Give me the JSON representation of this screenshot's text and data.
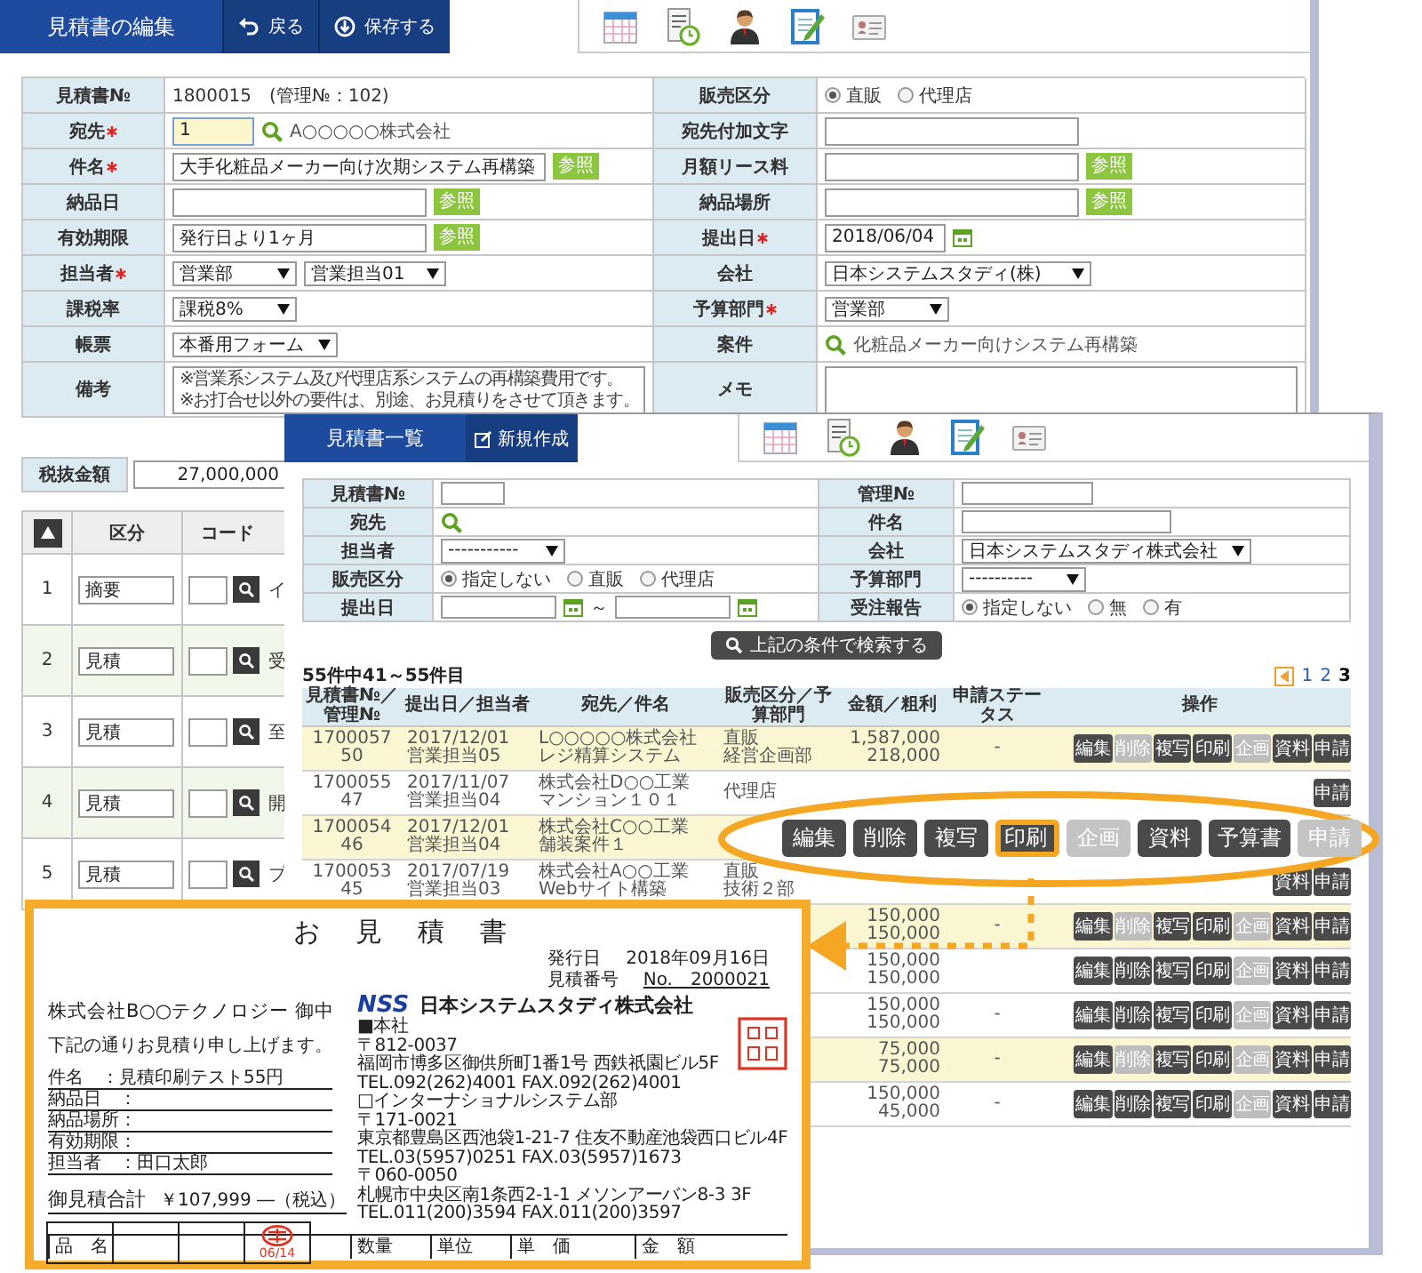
{
  "edit_window": {
    "title": "見積書の編集",
    "actions": [
      {
        "kind": "back",
        "label": "戻る"
      },
      {
        "kind": "save",
        "label": "保存する"
      }
    ],
    "form_rows": [
      {
        "cells": [
          {
            "label": "見積書№",
            "required": false,
            "kind": "text",
            "value": "1800015　(管理№：102)"
          },
          {
            "label": "販売区分",
            "required": false,
            "kind": "radio",
            "options": [
              {
                "label": "直販",
                "selected": true
              },
              {
                "label": "代理店",
                "selected": false
              }
            ]
          }
        ]
      },
      {
        "cells": [
          {
            "label": "宛先",
            "required": true,
            "kind": "lookup",
            "value": "1",
            "focused": true,
            "link_text": "A○○○○○株式会社"
          },
          {
            "label": "宛先付加文字",
            "required": false,
            "kind": "input",
            "focused": false
          }
        ]
      },
      {
        "cells": [
          {
            "label": "件名",
            "required": true,
            "kind": "input",
            "value": "大手化粧品メーカー向け次期システム再構築",
            "focused": false,
            "button": "参照"
          },
          {
            "label": "月額リース料",
            "required": false,
            "kind": "input",
            "focused": false,
            "button": "参照"
          }
        ]
      },
      {
        "cells": [
          {
            "label": "納品日",
            "required": false,
            "kind": "input",
            "focused": false,
            "button": "参照"
          },
          {
            "label": "納品場所",
            "required": false,
            "kind": "input",
            "focused": false,
            "button": "参照"
          }
        ]
      },
      {
        "cells": [
          {
            "label": "有効期限",
            "required": false,
            "kind": "input",
            "value": "発行日より1ヶ月",
            "focused": false,
            "button": "参照"
          },
          {
            "label": "提出日",
            "required": true,
            "kind": "date",
            "value": "2018/06/04",
            "focused": false
          }
        ]
      },
      {
        "cells": [
          {
            "label": "担当者",
            "required": true,
            "kind": "select",
            "selects": [
              "営業部",
              "営業担当01"
            ]
          },
          {
            "label": "会社",
            "required": false,
            "kind": "select",
            "selects": [
              "日本システムスタディ(株)"
            ]
          }
        ]
      },
      {
        "cells": [
          {
            "label": "課税率",
            "required": false,
            "kind": "select",
            "selects": [
              "課税8%"
            ]
          },
          {
            "label": "予算部門",
            "required": true,
            "kind": "select",
            "selects": [
              "営業部"
            ]
          }
        ]
      },
      {
        "cells": [
          {
            "label": "帳票",
            "required": false,
            "kind": "select",
            "selects": [
              "本番用フォーム"
            ]
          },
          {
            "label": "案件",
            "required": false,
            "kind": "search",
            "value": "化粧品メーカー向けシステム再構築"
          }
        ]
      },
      {
        "cells": [
          {
            "label": "備考",
            "required": false,
            "kind": "textarea",
            "value": "※営業系システム及び代理店系システムの再構築費用です。\n※お打合せ以外の要件は、別途、お見積りをさせて頂きます。"
          },
          {
            "label": "メモ",
            "required": false,
            "kind": "textarea"
          }
        ]
      }
    ],
    "tax_total": {
      "label": "税抜金額",
      "value": "27,000,000"
    },
    "detail": {
      "columns": [
        "区分",
        "コード"
      ],
      "rows": [
        {
          "no": "1",
          "type": "摘要",
          "text": "イ"
        },
        {
          "no": "2",
          "type": "見積",
          "text": "受"
        },
        {
          "no": "3",
          "type": "見積",
          "text": "至"
        },
        {
          "no": "4",
          "type": "見積",
          "text": "開"
        },
        {
          "no": "5",
          "type": "見積",
          "text": "プ"
        }
      ]
    }
  },
  "list_window": {
    "title": "見積書一覧",
    "new_label": "新規作成",
    "filter_rows": [
      {
        "cells": [
          {
            "label": "見積書№",
            "kind": "input"
          },
          {
            "label": "管理№",
            "kind": "input"
          }
        ]
      },
      {
        "cells": [
          {
            "label": "宛先",
            "kind": "search"
          },
          {
            "label": "件名",
            "kind": "input"
          }
        ]
      },
      {
        "cells": [
          {
            "label": "担当者",
            "kind": "select",
            "selects": [
              "-----------"
            ]
          },
          {
            "label": "会社",
            "kind": "select",
            "selects": [
              "日本システムスタディ株式会社"
            ]
          }
        ]
      },
      {
        "cells": [
          {
            "label": "販売区分",
            "kind": "radio",
            "options": [
              {
                "label": "指定しない",
                "selected": true
              },
              {
                "label": "直販",
                "selected": false
              },
              {
                "label": "代理店",
                "selected": false
              }
            ]
          },
          {
            "label": "予算部門",
            "kind": "select",
            "selects": [
              "----------"
            ]
          }
        ]
      },
      {
        "cells": [
          {
            "label": "提出日",
            "kind": "date_range",
            "separator": "～"
          },
          {
            "label": "受注報告",
            "kind": "radio",
            "options": [
              {
                "label": "指定しない",
                "selected": true
              },
              {
                "label": "無",
                "selected": false
              },
              {
                "label": "有",
                "selected": false
              }
            ]
          }
        ]
      }
    ],
    "search_label": "上記の条件で検索する",
    "count": "55件中41～55件目",
    "pages": [
      {
        "label": "1",
        "selected": false
      },
      {
        "label": "2",
        "selected": false
      },
      {
        "label": "3",
        "selected": true
      }
    ],
    "columns": [
      "見積書№／管理№",
      "提出日／担当者",
      "宛先／件名",
      "販売区分／予算部門",
      "金額／粗利",
      "申請ステータス",
      "操作"
    ],
    "rows": [
      {
        "highlighted": true,
        "no": "1700057",
        "mgmt": "50",
        "date": "2017/12/01",
        "staff": "営業担当05",
        "client": "L○○○○○株式会社",
        "subject": "レジ精算システム",
        "sales": "直販",
        "dept": "経営企画部",
        "amount": "1,587,000",
        "profit": "218,000",
        "status": "-",
        "buttons": [
          {
            "label": "編集",
            "disabled": false
          },
          {
            "label": "削除",
            "disabled": true
          },
          {
            "label": "複写",
            "disabled": false
          },
          {
            "label": "印刷",
            "disabled": false
          },
          {
            "label": "企画",
            "disabled": true
          },
          {
            "label": "資料",
            "disabled": false
          },
          {
            "label": "申請",
            "disabled": false
          }
        ]
      },
      {
        "highlighted": false,
        "no": "1700055",
        "mgmt": "47",
        "date": "2017/11/07",
        "staff": "営業担当04",
        "client": "株式会社D○○工業",
        "subject": "マンション１０１",
        "sales": "代理店",
        "buttons": [
          {
            "label": "申請",
            "disabled": false
          }
        ]
      },
      {
        "highlighted": true,
        "no": "1700054",
        "mgmt": "46",
        "date": "2017/12/01",
        "staff": "営業担当04",
        "client": "株式会社C○○工業",
        "subject": "舗装案件１"
      },
      {
        "highlighted": false,
        "no": "1700053",
        "mgmt": "45",
        "date": "2017/07/19",
        "staff": "営業担当03",
        "client": "株式会社A○○工業",
        "subject": "Webサイト構築",
        "sales": "直販",
        "dept": "技術２部",
        "buttons": [
          {
            "label": "資料",
            "disabled": false
          },
          {
            "label": "申請",
            "disabled": false
          }
        ]
      },
      {
        "highlighted": true,
        "amount": "150,000",
        "profit": "150,000",
        "status": "-",
        "buttons": [
          {
            "label": "編集",
            "disabled": false
          },
          {
            "label": "削除",
            "disabled": true
          },
          {
            "label": "複写",
            "disabled": false
          },
          {
            "label": "印刷",
            "disabled": false
          },
          {
            "label": "企画",
            "disabled": true
          },
          {
            "label": "資料",
            "disabled": false
          },
          {
            "label": "申請",
            "disabled": false
          }
        ]
      },
      {
        "highlighted": false,
        "amount": "150,000",
        "profit": "150,000",
        "buttons": [
          {
            "label": "編集",
            "disabled": false
          },
          {
            "label": "削除",
            "disabled": false
          },
          {
            "label": "複写",
            "disabled": false
          },
          {
            "label": "印刷",
            "disabled": false
          },
          {
            "label": "企画",
            "disabled": true
          },
          {
            "label": "資料",
            "disabled": false
          },
          {
            "label": "申請",
            "disabled": false
          }
        ]
      },
      {
        "highlighted": false,
        "amount": "150,000",
        "profit": "150,000",
        "status": "-",
        "buttons": [
          {
            "label": "編集",
            "disabled": false
          },
          {
            "label": "削除",
            "disabled": false
          },
          {
            "label": "複写",
            "disabled": false
          },
          {
            "label": "印刷",
            "disabled": false
          },
          {
            "label": "企画",
            "disabled": true
          },
          {
            "label": "資料",
            "disabled": false
          },
          {
            "label": "申請",
            "disabled": false
          }
        ]
      },
      {
        "highlighted": true,
        "amount": "75,000",
        "profit": "75,000",
        "status": "-",
        "buttons": [
          {
            "label": "編集",
            "disabled": false
          },
          {
            "label": "削除",
            "disabled": true
          },
          {
            "label": "複写",
            "disabled": false
          },
          {
            "label": "印刷",
            "disabled": false
          },
          {
            "label": "企画",
            "disabled": true
          },
          {
            "label": "資料",
            "disabled": false
          },
          {
            "label": "申請",
            "disabled": false
          }
        ]
      },
      {
        "highlighted": false,
        "amount": "150,000",
        "profit": "45,000",
        "status": "-",
        "buttons": [
          {
            "label": "編集",
            "disabled": false
          },
          {
            "label": "削除",
            "disabled": false
          },
          {
            "label": "複写",
            "disabled": false
          },
          {
            "label": "印刷",
            "disabled": false
          },
          {
            "label": "企画",
            "disabled": true
          },
          {
            "label": "資料",
            "disabled": false
          },
          {
            "label": "申請",
            "disabled": false
          }
        ]
      }
    ]
  },
  "callout": {
    "buttons": [
      {
        "label": "編集",
        "disabled": false,
        "selected": false
      },
      {
        "label": "削除",
        "disabled": false,
        "selected": false
      },
      {
        "label": "複写",
        "disabled": false,
        "selected": false
      },
      {
        "label": "印刷",
        "disabled": false,
        "selected": true
      },
      {
        "label": "企画",
        "disabled": true,
        "selected": false
      },
      {
        "label": "資料",
        "disabled": false,
        "selected": false
      },
      {
        "label": "予算書",
        "disabled": false,
        "selected": false
      },
      {
        "label": "申請",
        "disabled": true,
        "selected": false
      }
    ]
  },
  "quote": {
    "title": "お見積書",
    "issue_label": "発行日",
    "issue_date": "2018年09月16日",
    "number_label": "見積番号",
    "number": "No.　2000021",
    "recipient": "株式会社B○○テクノロジー 御中",
    "greeting": "下記の通りお見積り申し上げます。",
    "fields": [
      "件名　：見積印刷テスト55円",
      "納品日　：",
      "納品場所：",
      "有効期限：",
      "担当者　：田口太郎"
    ],
    "total_label": "御見積合計",
    "total": "￥107,999 ―（税込）",
    "logo": "NSS",
    "company": "日本システムスタディ株式会社",
    "address": [
      "■本社",
      "〒812-0037",
      "福岡市博多区御供所町1番1号 西鉄祇園ビル5F",
      "TEL.092(262)4001 FAX.092(262)4001",
      "□インターナショナルシステム部",
      "〒171-0021",
      "東京都豊島区西池袋1-21-7 住友不動産池袋西口ビル4F",
      "TEL.03(5957)0251 FAX.03(5957)1673",
      "〒060-0050",
      "札幌市中央区南1条西2-1-1 メソンアーバン8-3 3F",
      "TEL.011(200)3594 FAX.011(200)3597"
    ],
    "stamp_date": "06/14",
    "item_columns": [
      "品　名",
      "数量",
      "単位",
      "単　価",
      "金　額"
    ]
  }
}
